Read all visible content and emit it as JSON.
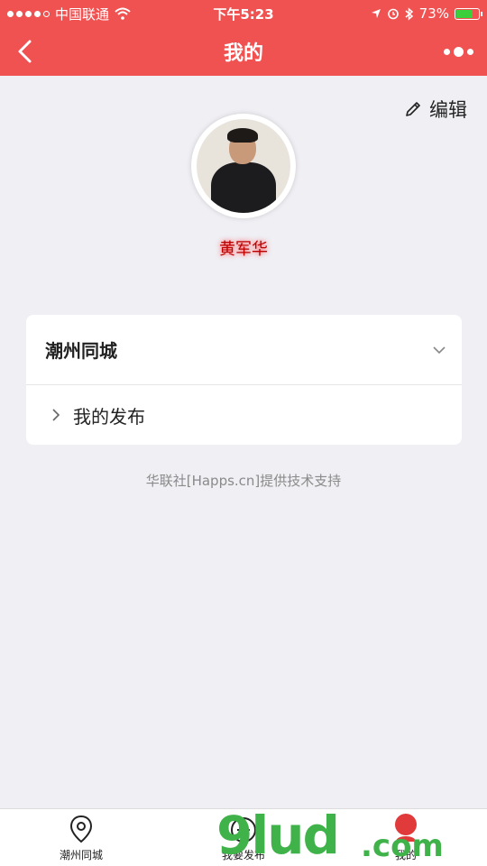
{
  "status_bar": {
    "carrier": "中国联通",
    "time": "下午5:23",
    "battery": "73%"
  },
  "nav": {
    "title": "我的"
  },
  "profile": {
    "edit_label": "编辑",
    "username": "黄军华"
  },
  "card": {
    "group_title": "潮州同城",
    "items": [
      {
        "label": "我的发布"
      }
    ]
  },
  "footer": {
    "support_text": "华联社[Happs.cn]提供技术支持"
  },
  "tabbar": {
    "tabs": [
      {
        "label": "潮州同城",
        "icon": "location-pin-icon"
      },
      {
        "label": "我要发布",
        "icon": "plus-circle-icon"
      },
      {
        "label": "我的",
        "icon": "user-icon"
      }
    ]
  },
  "watermark": {
    "text": "9lud",
    "suffix": ".com"
  },
  "colors": {
    "accent": "#f05252",
    "background": "#efeff4"
  }
}
